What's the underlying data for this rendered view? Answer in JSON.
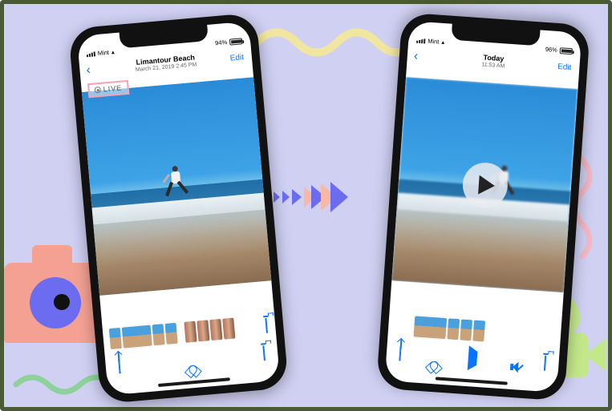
{
  "decor": {
    "camera_icon": "camera-icon",
    "video_icon": "video-camera-icon"
  },
  "phone_left": {
    "status": {
      "carrier": "Mint",
      "wifi": "wifi-icon",
      "battery_pct": "94%"
    },
    "nav": {
      "title_line1": "Limantour Beach",
      "title_line2": "March 21, 2019  2:45 PM",
      "edit": "Edit"
    },
    "live_badge": "LIVE",
    "toolbar": {
      "share": "share-icon",
      "heart": "favorite-icon",
      "trash": "trash-icon"
    }
  },
  "phone_right": {
    "status": {
      "carrier": "Mint",
      "wifi": "wifi-icon",
      "battery_pct": "96%"
    },
    "nav": {
      "title_line1": "Today",
      "title_line2": "11:53 AM",
      "edit": "Edit"
    },
    "play_button": "play-icon",
    "toolbar": {
      "share": "share-icon",
      "heart": "favorite-icon",
      "play": "play-icon",
      "mute": "mute-icon",
      "trash": "trash-icon"
    }
  }
}
